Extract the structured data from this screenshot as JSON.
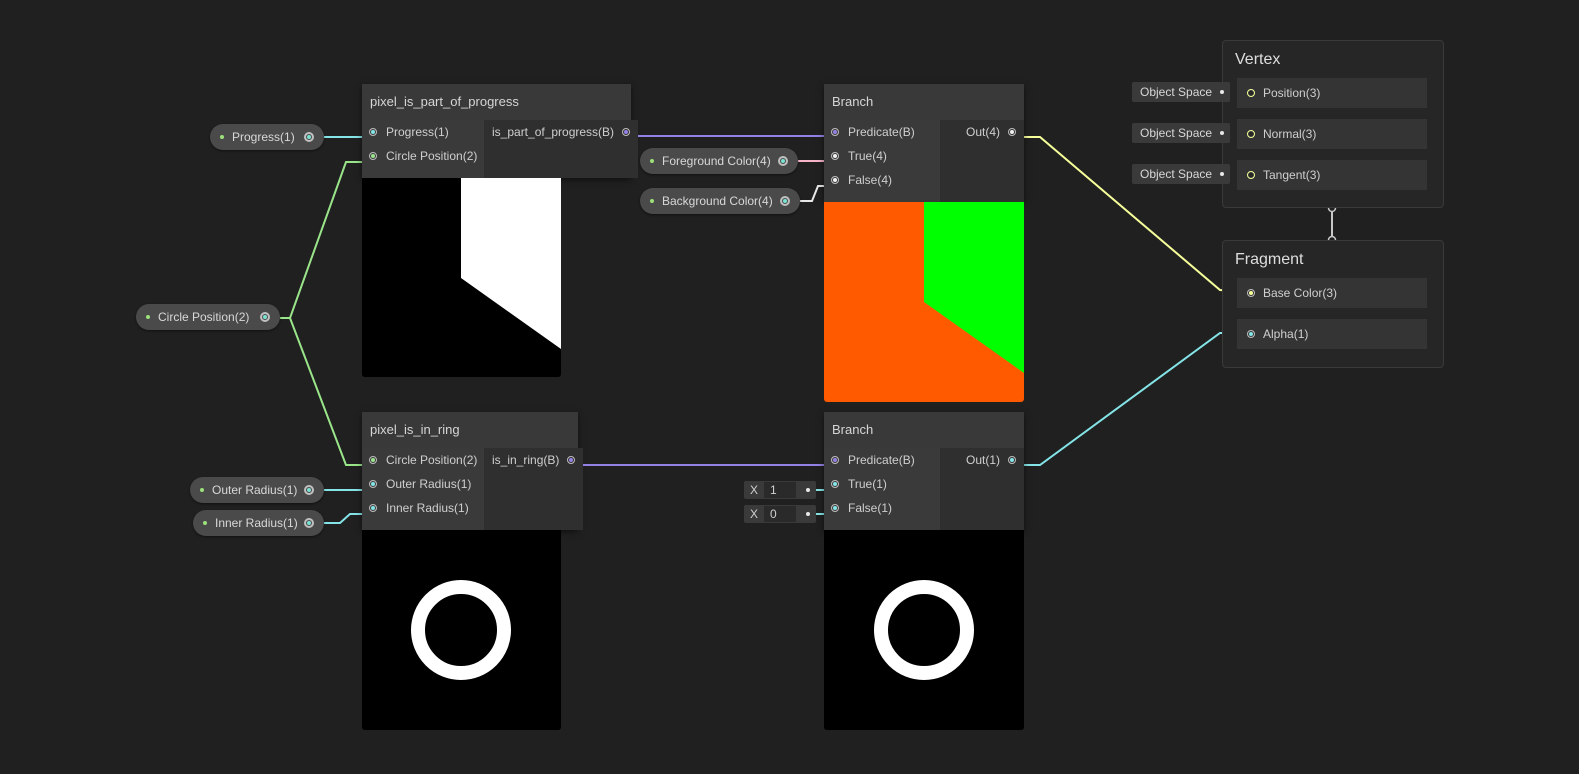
{
  "properties": {
    "progress": "Progress(1)",
    "circle_position": "Circle Position(2)",
    "foreground_color": "Foreground Color(4)",
    "background_color": "Background Color(4)",
    "outer_radius": "Outer Radius(1)",
    "inner_radius": "Inner Radius(1)"
  },
  "progress_node": {
    "title": "pixel_is_part_of_progress",
    "inputs": [
      "Progress(1)",
      "Circle Position(2)"
    ],
    "output": "is_part_of_progress(B)"
  },
  "ring_node": {
    "title": "pixel_is_in_ring",
    "inputs": [
      "Circle Position(2)",
      "Outer Radius(1)",
      "Inner Radius(1)"
    ],
    "output": "is_in_ring(B)"
  },
  "branch_color": {
    "title": "Branch",
    "inputs": [
      "Predicate(B)",
      "True(4)",
      "False(4)"
    ],
    "output": "Out(4)"
  },
  "branch_alpha": {
    "title": "Branch",
    "inputs": [
      "Predicate(B)",
      "True(1)",
      "False(1)"
    ],
    "output": "Out(1)",
    "true_value": {
      "label": "X",
      "value": "1"
    },
    "false_value": {
      "label": "X",
      "value": "0"
    }
  },
  "vertex": {
    "title": "Vertex",
    "slots": [
      "Position(3)",
      "Normal(3)",
      "Tangent(3)"
    ],
    "space": "Object Space"
  },
  "fragment": {
    "title": "Fragment",
    "slots": [
      "Base Color(3)",
      "Alpha(1)"
    ]
  },
  "colors": {
    "background": "#202020",
    "preview_orange": "#ff5a00",
    "preview_green": "#00ff00",
    "wire_float": "#84e4e7",
    "wire_vector2": "#9ae58a",
    "wire_bool": "#9481e6",
    "wire_color": "#f6b4c9",
    "wire_vector3": "#f6ff9a"
  }
}
